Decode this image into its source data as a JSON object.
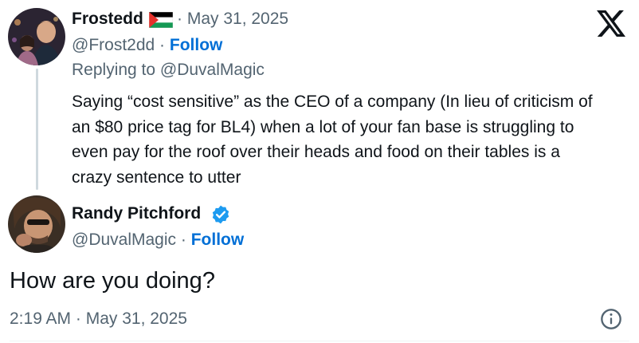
{
  "quoted_post": {
    "display_name": "Frostedd",
    "date": "May 31, 2025",
    "handle": "@Frost2dd",
    "follow_label": "Follow",
    "replying_to": "Replying to @DuvalMagic",
    "body_lines": [
      "Saying “cost sensitive” as the CEO of a company (In lieu of criticism of",
      "an $80 price tag for BL4) when a lot of your fan base is struggling to",
      "even pay for the roof over their heads and food on their tables is a",
      "crazy sentence to utter"
    ]
  },
  "main_post": {
    "display_name": "Randy Pitchford",
    "handle": "@DuvalMagic",
    "follow_label": "Follow",
    "text": "How are you doing?",
    "timestamp": "2:19 AM · May 31, 2025"
  },
  "separator": "·",
  "icons": {
    "brand": "x-logo-icon",
    "flag": "palestine-flag-icon",
    "verified": "verified-badge-icon",
    "info": "info-icon"
  },
  "colors": {
    "text": "#0f1419",
    "secondary": "#536471",
    "follow": "#006fd6",
    "verified": "#1d9bf0",
    "thread_line": "#cfd9de"
  }
}
